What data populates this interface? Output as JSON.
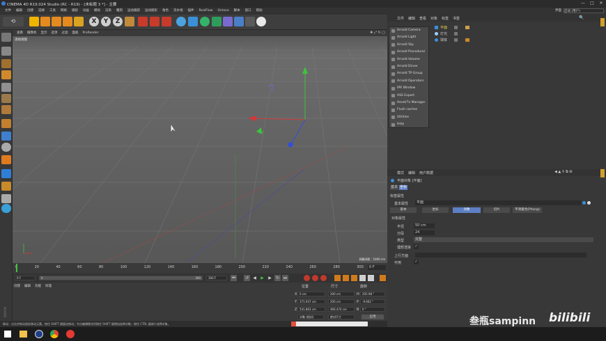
{
  "app": {
    "title": "CINEMA 4D R19.024 Studio (RC - R19) - [未标题 3 *] - 主要"
  },
  "window_buttons": [
    "—",
    "□",
    "✕"
  ],
  "menubar": [
    "文件",
    "编辑",
    "创建",
    "选择",
    "工具",
    "网格",
    "捕捉",
    "动画",
    "模拟",
    "渲染",
    "雕刻",
    "运动跟踪",
    "运动图形",
    "角色",
    "流水线",
    "插件",
    "RealFlow",
    "Octane",
    "脚本",
    "窗口",
    "帮助"
  ],
  "layout_label": "界面",
  "layout_value": "启动 (用户)",
  "viewport": {
    "menu": [
      "查看",
      "摄像机",
      "显示",
      "选项",
      "过滤",
      "面板",
      "ProRender"
    ],
    "label": "透视视图",
    "grid_info": "网格间距 : 1000 cm"
  },
  "timeline": {
    "ticks": [
      "0",
      "20",
      "40",
      "60",
      "80",
      "100",
      "120",
      "140",
      "160",
      "180",
      "200",
      "220",
      "240",
      "260",
      "280",
      "300"
    ],
    "frame": "0 F"
  },
  "transport": {
    "start": "0 F",
    "end_a": "300 F",
    "end_b": "300 F",
    "slider_a": "0",
    "slider_b": "300"
  },
  "materials": {
    "menu": [
      "创建",
      "编辑",
      "功能",
      "纹理"
    ]
  },
  "coords": {
    "headers": [
      "位置",
      "尺寸",
      "旋转"
    ],
    "rows": [
      {
        "axis": "X",
        "pos": "0 cm",
        "size": "200 cm",
        "rotl": "H",
        "rot": "205.98 °"
      },
      {
        "axis": "Y",
        "pos": "371.937 cm",
        "size": "200 cm",
        "rotl": "P",
        "rot": "-9.662 °"
      },
      {
        "axis": "Z",
        "pos": "541.863 cm",
        "size": "466.474 cm",
        "rotl": "B",
        "rot": "0 °"
      }
    ],
    "mode_a": "对象 (相对)",
    "mode_b": "绝对尺寸",
    "apply": "应用"
  },
  "status_text": "移动：点击并拖动鼠标移动元素。按住 SHIFT 键量化移动；节点编辑模式时按住 SHIFT 键增加选择对象；按住 CTRL 键减少选择对象。",
  "objects": {
    "menu": [
      "文件",
      "编辑",
      "查看",
      "对象",
      "标签",
      "书签"
    ],
    "rows": [
      {
        "name": "平面",
        "color": "#e6d34a"
      },
      {
        "name": "灯光",
        "color": "#cfcfcf"
      },
      {
        "name": "球体",
        "color": "#cfcfcf"
      }
    ]
  },
  "arnold_menu": [
    "Arnold Camera",
    "Arnold Light",
    "Arnold Sky",
    "Arnold Procedural",
    "Arnold Volume",
    "Arnold Driver",
    "Arnold TP Group",
    "Arnold Operators",
    "IPR Window",
    "ASS Export",
    "Asset/Tx Manager",
    "Flush caches",
    "Utilities",
    "Help"
  ],
  "attributes": {
    "menu": [
      "模式",
      "编辑",
      "用户数据"
    ],
    "object_label": "平面对象 [平面]",
    "mode_tabs": [
      "基本",
      "坐标"
    ],
    "section": "标签属性",
    "name_label": "基本属性",
    "name_value": "平面",
    "tabs": [
      "基本",
      "坐标",
      "对象",
      "切片",
      "平滑着色(Phong)"
    ],
    "active_tab": 2,
    "obj_title": "对象属性",
    "props": [
      {
        "label": "半径",
        "value": "50 cm"
      },
      {
        "label": "分段",
        "value": "24"
      },
      {
        "label": "类型",
        "value": "完整"
      },
      {
        "label": "理想渲染",
        "value": "✓"
      }
    ],
    "render": [
      {
        "label": "上行方面",
        "value": ""
      },
      {
        "label": "可用",
        "value": "✓"
      }
    ]
  },
  "watermark": "叁瓶sampinn",
  "watermark_brand": "bilibili",
  "taskbar_icons": [
    "windows-icon",
    "explorer-icon",
    "chrome-icon",
    "cinema4d-icon",
    "record-icon"
  ],
  "colors": {
    "accent": "#5e7fc4",
    "y_axis": "#3ec43e",
    "x_axis": "#d03a3a",
    "z_axis": "#2f4fe0"
  }
}
